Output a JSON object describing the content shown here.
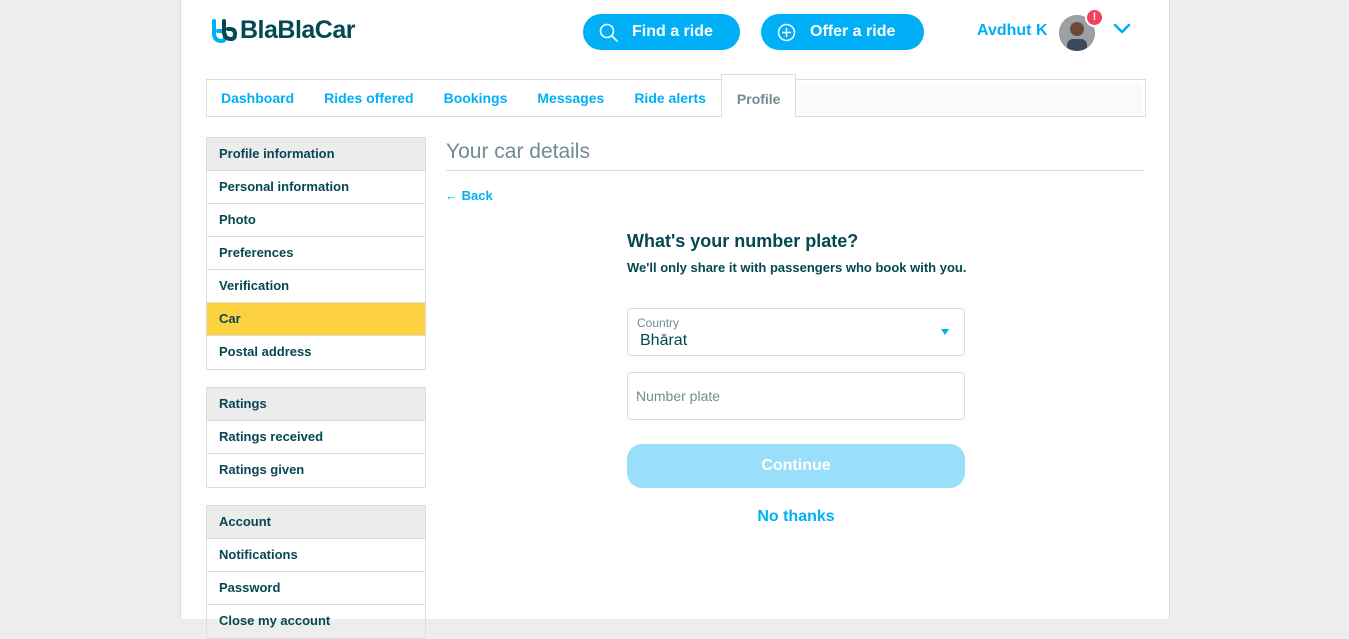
{
  "brand": {
    "name": "BlaBlaCar"
  },
  "header": {
    "find_ride": "Find a ride",
    "offer_ride": "Offer a ride",
    "user_name": "Avdhut K",
    "notification_badge": "!"
  },
  "tabs": [
    {
      "label": "Dashboard"
    },
    {
      "label": "Rides offered"
    },
    {
      "label": "Bookings"
    },
    {
      "label": "Messages"
    },
    {
      "label": "Ride alerts"
    },
    {
      "label": "Profile",
      "active": true
    }
  ],
  "sidebar": {
    "profile": {
      "heading": "Profile information",
      "items": [
        "Personal information",
        "Photo",
        "Preferences",
        "Verification",
        "Car",
        "Postal address"
      ]
    },
    "ratings": {
      "heading": "Ratings",
      "items": [
        "Ratings received",
        "Ratings given"
      ]
    },
    "account": {
      "heading": "Account",
      "items": [
        "Notifications",
        "Password",
        "Close my account"
      ]
    }
  },
  "main": {
    "title": "Your car details",
    "back": "← Back",
    "question": "What's your number plate?",
    "subtitle": "We'll only share it with passengers who book with you.",
    "country_label": "Country",
    "country_value": "Bhārat",
    "plate_placeholder": "Number plate",
    "continue": "Continue",
    "no_thanks": "No thanks"
  },
  "colors": {
    "accent": "#00aff5",
    "text": "#054752",
    "muted": "#708c91",
    "active_sidebar": "#fdd240",
    "badge": "#f53f5b",
    "disabled_button": "#99dff9"
  }
}
